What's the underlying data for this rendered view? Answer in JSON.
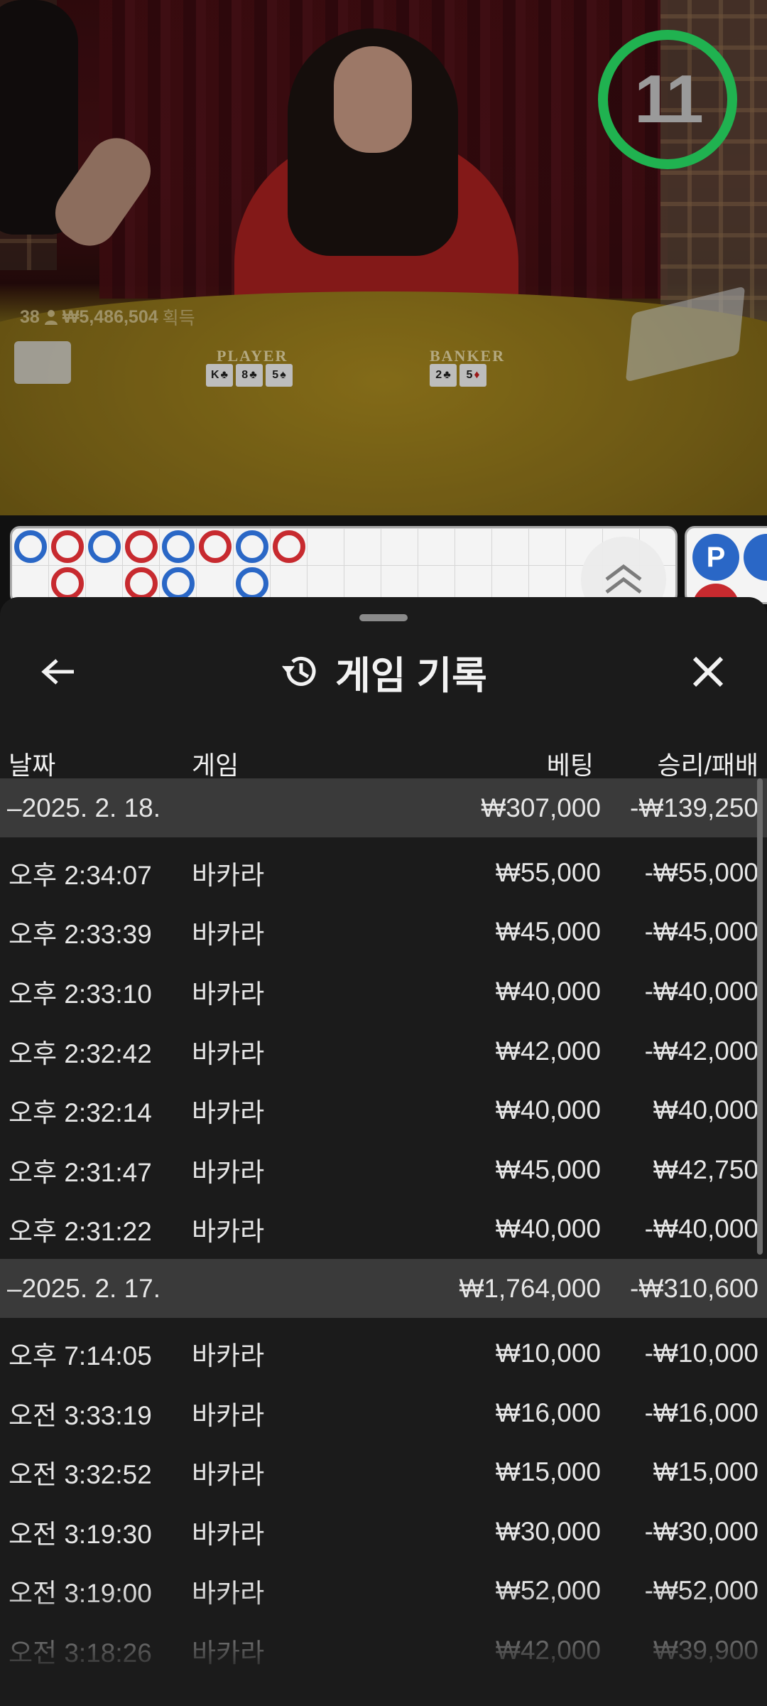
{
  "video": {
    "timer": "11",
    "table_labels": {
      "player": "PLAYER",
      "banker": "BANKER"
    },
    "payout": {
      "count": "38",
      "amount": "₩5,486,504",
      "suffix": "획득"
    },
    "player_cards": [
      {
        "rank": "K",
        "suit": "♣"
      },
      {
        "rank": "8",
        "suit": "♣"
      },
      {
        "rank": "5",
        "suit": "♠"
      }
    ],
    "banker_cards": [
      {
        "rank": "2",
        "suit": "♣"
      },
      {
        "rank": "5",
        "suit": "♦"
      }
    ]
  },
  "roadmap": {
    "beads": [
      {
        "col": 0,
        "row": 0,
        "side": "p"
      },
      {
        "col": 1,
        "row": 0,
        "side": "b"
      },
      {
        "col": 1,
        "row": 1,
        "side": "b"
      },
      {
        "col": 2,
        "row": 0,
        "side": "p"
      },
      {
        "col": 3,
        "row": 0,
        "side": "b"
      },
      {
        "col": 3,
        "row": 1,
        "side": "b"
      },
      {
        "col": 4,
        "row": 0,
        "side": "p"
      },
      {
        "col": 4,
        "row": 1,
        "side": "p"
      },
      {
        "col": 5,
        "row": 0,
        "side": "b"
      },
      {
        "col": 6,
        "row": 0,
        "side": "p"
      },
      {
        "col": 6,
        "row": 1,
        "side": "p"
      },
      {
        "col": 7,
        "row": 0,
        "side": "b"
      }
    ],
    "side_board_label": "P"
  },
  "sheet": {
    "title": "게임 기록",
    "icons": {
      "back": "back-arrow-icon",
      "history": "history-icon",
      "close": "close-icon"
    },
    "columns": {
      "date": "날짜",
      "game": "게임",
      "bet": "베팅",
      "result": "승리/패배"
    },
    "groups": [
      {
        "date": "–2025. 2. 18.",
        "bet": "₩307,000",
        "result": "-₩139,250",
        "rows": [
          {
            "time": "오후 2:34:07",
            "game": "바카라",
            "bet": "₩55,000",
            "result": "-₩55,000"
          },
          {
            "time": "오후 2:33:39",
            "game": "바카라",
            "bet": "₩45,000",
            "result": "-₩45,000"
          },
          {
            "time": "오후 2:33:10",
            "game": "바카라",
            "bet": "₩40,000",
            "result": "-₩40,000"
          },
          {
            "time": "오후 2:32:42",
            "game": "바카라",
            "bet": "₩42,000",
            "result": "-₩42,000"
          },
          {
            "time": "오후 2:32:14",
            "game": "바카라",
            "bet": "₩40,000",
            "result": "₩40,000"
          },
          {
            "time": "오후 2:31:47",
            "game": "바카라",
            "bet": "₩45,000",
            "result": "₩42,750"
          },
          {
            "time": "오후 2:31:22",
            "game": "바카라",
            "bet": "₩40,000",
            "result": "-₩40,000"
          }
        ]
      },
      {
        "date": "–2025. 2. 17.",
        "bet": "₩1,764,000",
        "result": "-₩310,600",
        "rows": [
          {
            "time": "오후 7:14:05",
            "game": "바카라",
            "bet": "₩10,000",
            "result": "-₩10,000"
          },
          {
            "time": "오전 3:33:19",
            "game": "바카라",
            "bet": "₩16,000",
            "result": "-₩16,000"
          },
          {
            "time": "오전 3:32:52",
            "game": "바카라",
            "bet": "₩15,000",
            "result": "₩15,000"
          },
          {
            "time": "오전 3:19:30",
            "game": "바카라",
            "bet": "₩30,000",
            "result": "-₩30,000"
          },
          {
            "time": "오전 3:19:00",
            "game": "바카라",
            "bet": "₩52,000",
            "result": "-₩52,000"
          },
          {
            "time": "오전 3:18:26",
            "game": "바카라",
            "bet": "₩42,000",
            "result": "₩39,900"
          }
        ]
      }
    ]
  }
}
